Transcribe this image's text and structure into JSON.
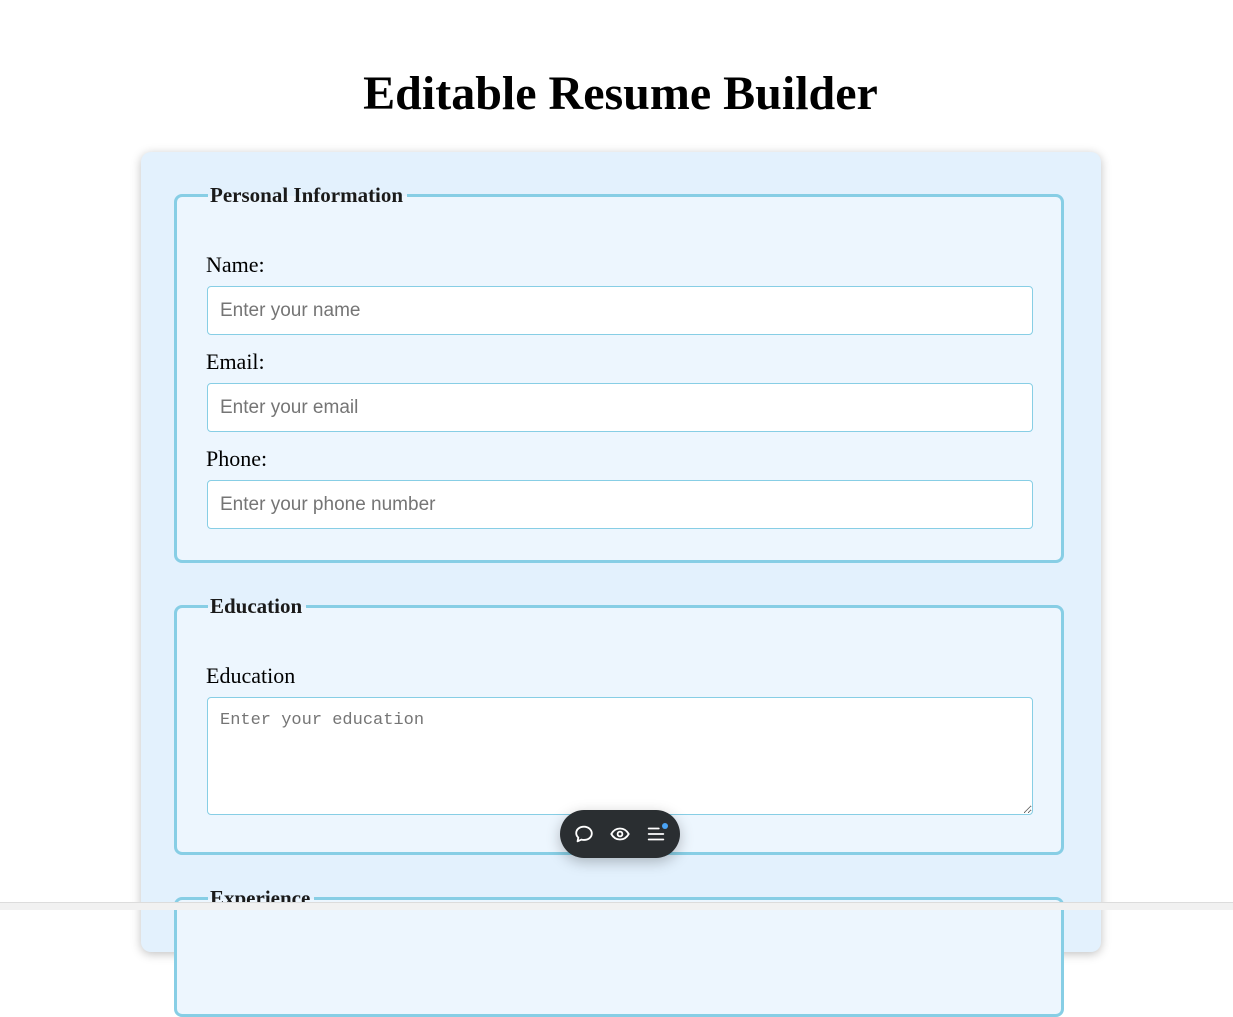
{
  "page": {
    "title": "Editable Resume Builder"
  },
  "sections": {
    "personal": {
      "legend": "Personal Information",
      "name_label": "Name:",
      "name_placeholder": "Enter your name",
      "name_value": "",
      "email_label": "Email:",
      "email_placeholder": "Enter your email",
      "email_value": "",
      "phone_label": "Phone:",
      "phone_placeholder": "Enter your phone number",
      "phone_value": ""
    },
    "education": {
      "legend": "Education",
      "label": "Education",
      "placeholder": "Enter your education",
      "value": ""
    },
    "experience": {
      "legend": "Experience"
    }
  },
  "toolbar": {
    "icons": [
      "chat-bubble-icon",
      "eye-icon",
      "menu-icon"
    ],
    "accent_color": "#4aa3f5"
  },
  "colors": {
    "card_background": "#e3f1fd",
    "section_background": "#edf6fe",
    "section_border": "#87cee5",
    "toolbar_background": "#2a2e31"
  }
}
